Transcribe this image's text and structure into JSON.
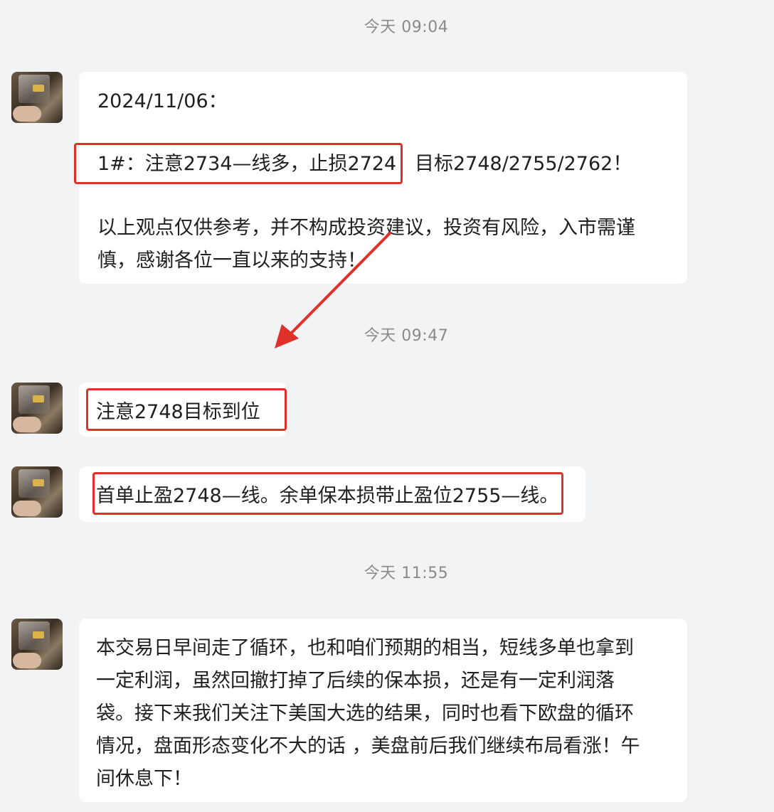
{
  "timestamps": [
    "今天 09:04",
    "今天 09:47",
    "今天 11:55"
  ],
  "messages": {
    "m1": {
      "line1": "2024/11/06：",
      "line2_highlight": "1#：注意2734—线多，止损2724",
      "line2_rest": "目标2748/2755/2762！",
      "line3": "以上观点仅供参考，并不构成投资建议，投资有风险，入市需谨",
      "line4": "慎，感谢各位一直以来的支持！"
    },
    "m2": {
      "text": "注意2748目标到位"
    },
    "m3": {
      "text": "首单止盈2748—线。余单保本损带止盈位2755—线。"
    },
    "m4": {
      "lines": [
        "本交易日早间走了循环，也和咱们预期的相当，短线多单也拿到",
        "一定利润，虽然回撤打掉了后续的保本损，还是有一定利润落",
        "袋。接下来我们关注下美国大选的结果，同时也看下欧盘的循环",
        "情况，盘面形态变化不大的话 ，美盘前后我们继续布局看涨！午",
        "间休息下！"
      ]
    }
  },
  "colors": {
    "background": "#f2f3f5",
    "bubble": "#ffffff",
    "highlight": "#e0302a",
    "timestamp": "#8a8a8a"
  },
  "icons": {
    "avatar": "profile-photo",
    "arrow": "red-arrow"
  }
}
